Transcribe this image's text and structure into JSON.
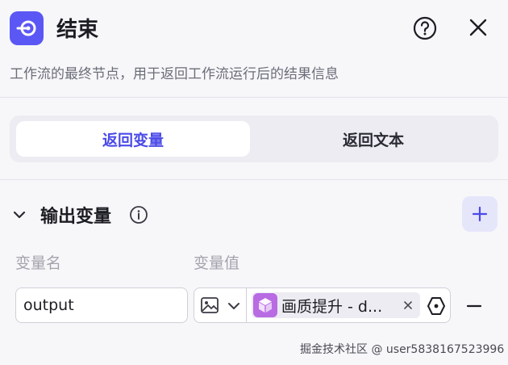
{
  "header": {
    "title": "结束",
    "description": "工作流的最终节点，用于返回工作流运行后的结果信息",
    "node_icon": "end-node-icon",
    "help_icon": "help-circle-icon",
    "close_icon": "close-icon"
  },
  "tabs": [
    {
      "label": "返回变量",
      "active": true
    },
    {
      "label": "返回文本",
      "active": false
    }
  ],
  "output_section": {
    "title": "输出变量",
    "info_icon": "info-icon",
    "add_icon": "plus-icon",
    "columns": {
      "name": "变量名",
      "value": "变量值"
    },
    "rows": [
      {
        "name": "output",
        "type_icon": "image-icon",
        "reference_label": "画质提升 - d...",
        "reference_icon": "plugin-cube-icon"
      }
    ]
  },
  "watermark": "掘金技术社区 @ user5838167523996",
  "colors": {
    "accent": "#4b4ae8",
    "node_icon_bg": "#5b57f5",
    "plugin_bg": "#b86be3"
  }
}
